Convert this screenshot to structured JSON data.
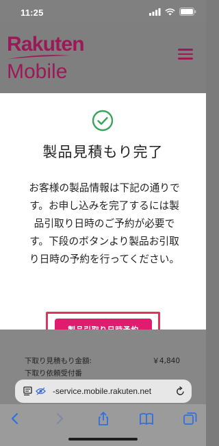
{
  "status": {
    "time": "11:25"
  },
  "header": {
    "logo_line1": "Rakuten",
    "logo_line2": "Mobile"
  },
  "modal": {
    "title": "製品見積もり完了",
    "body_lines": [
      "お客様の製品情報は下記の通りで",
      "す。お申し込みを完了するには製",
      "品引取り日時のご予約が必要で",
      "す。下段のボタンより製品お引取",
      "り日時の予約を行ってください。"
    ],
    "button_label": "製品引取り日時予約"
  },
  "details": {
    "trade_in_label": "下取り見積もり金額:",
    "trade_in_value": "￥4,840",
    "partial_label": "下取り依頼受付番"
  },
  "browser": {
    "url": "-service.mobile.rakuten.net"
  },
  "colors": {
    "brand": "#9c1957",
    "button": "#e01c6e",
    "highlight": "#e2325a",
    "success": "#3aa35a"
  }
}
